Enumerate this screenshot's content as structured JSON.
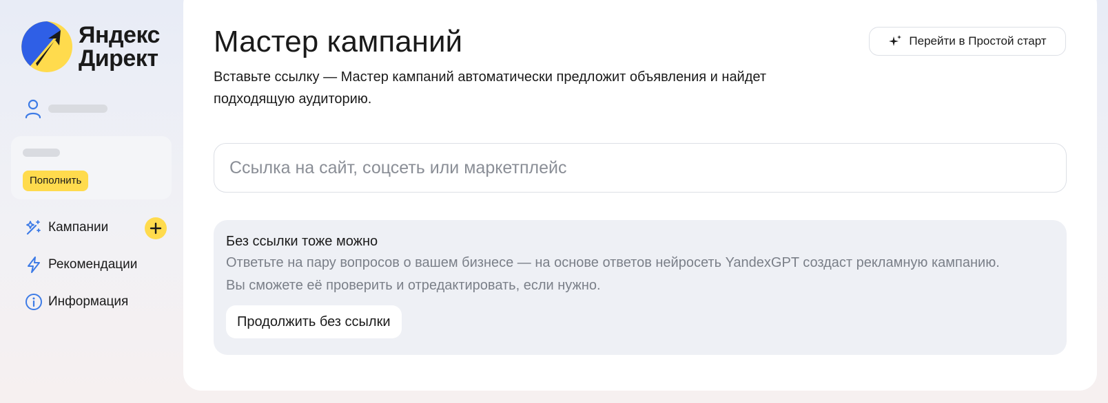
{
  "brand": {
    "line1": "Яндекс",
    "line2": "Директ",
    "colors": {
      "blue": "#2f5fe6",
      "yellow": "#ffdb4d"
    }
  },
  "sidebar": {
    "topup_label": "Пополнить",
    "nav": [
      {
        "label": "Кампании",
        "icon": "magic-wand-icon"
      },
      {
        "label": "Рекомендации",
        "icon": "lightning-icon"
      },
      {
        "label": "Информация",
        "icon": "info-icon"
      }
    ],
    "add_icon": "plus-icon"
  },
  "main": {
    "title": "Мастер кампаний",
    "description": "Вставьте ссылку — Мастер кампаний автоматически предложит объявления и найдет подходящую аудиторию.",
    "simple_start_label": "Перейти в Простой старт",
    "simple_start_icon": "sparkle-icon",
    "url_input": {
      "placeholder": "Ссылка на сайт, соцсеть или маркетплейс",
      "value": ""
    },
    "no_link": {
      "title": "Без ссылки тоже можно",
      "text": "Ответьте на пару вопросов о вашем бизнесе — на основе ответов нейросеть YandexGPT создаст рекламную кампанию. Вы сможете её проверить и отредактировать, если нужно.",
      "button_label": "Продолжить без ссылки"
    }
  }
}
